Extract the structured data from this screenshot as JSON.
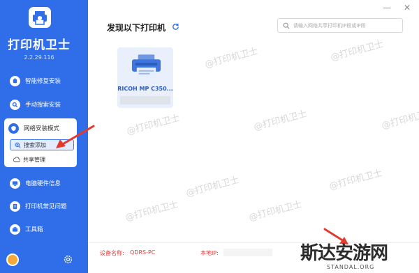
{
  "app": {
    "title": "打印机卫士",
    "version": "2.2.29.116"
  },
  "sidebar": {
    "items": [
      {
        "label": "智能修复安装",
        "icon": "wrench-icon"
      },
      {
        "label": "手动搜索安装",
        "icon": "search-icon"
      },
      {
        "label": "电脑硬件信息",
        "icon": "monitor-icon"
      },
      {
        "label": "打印机常见问题",
        "icon": "question-icon"
      },
      {
        "label": "工具箱",
        "icon": "toolbox-icon"
      }
    ],
    "network_section": {
      "label": "网络安装模式",
      "sub_items": [
        {
          "label": "搜索添加",
          "active": true
        },
        {
          "label": "共享管理",
          "active": false
        }
      ]
    }
  },
  "window_controls": {
    "minimize": "—",
    "close": "✕"
  },
  "main": {
    "heading": "发现以下打印机",
    "search": {
      "placeholder": "请输入网络共享打印机IP段或IP段",
      "value": ""
    },
    "printers": [
      {
        "name": "RICOH MP C350..."
      }
    ]
  },
  "footer": {
    "device_label": "设备名称:",
    "device_value": "QDRS-PC",
    "ip_label": "本地IP:"
  },
  "watermarks": {
    "text": "@打印机卫士",
    "corner_title": "斯达安游网",
    "corner_sub": "STANDAL.ORG"
  },
  "colors": {
    "sidebar": "#2f6ee8",
    "accent_red": "#e23a3a",
    "card_bg": "#e9f0fc"
  }
}
